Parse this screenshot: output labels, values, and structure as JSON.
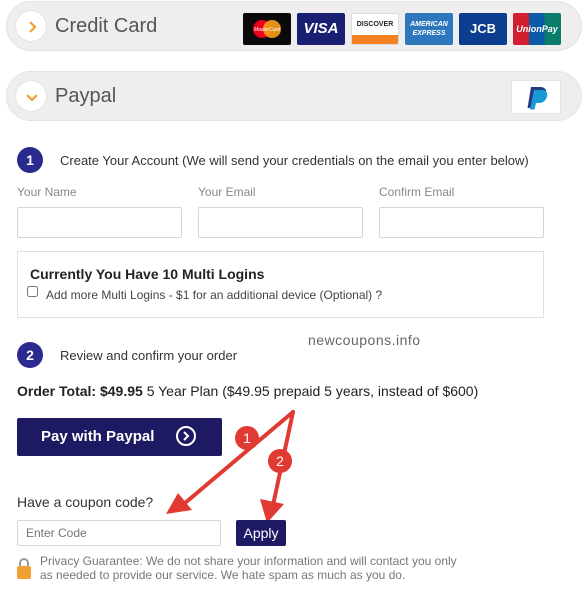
{
  "credit_card": {
    "title": "Credit Card",
    "cards": [
      "MasterCard",
      "VISA",
      "DISCOVER",
      "AMERICAN EXPRESS",
      "JCB",
      "UnionPay"
    ]
  },
  "paypal_panel": {
    "title": "Paypal"
  },
  "step1": {
    "number": "1",
    "text": "Create Your Account (We will send your credentials on the email you enter below)",
    "fields": {
      "name_label": "Your Name",
      "email_label": "Your Email",
      "confirm_label": "Confirm Email"
    }
  },
  "multi_logins": {
    "heading": "Currently You Have 10 Multi Logins",
    "checkbox_label": "Add more Multi Logins - $1 for an additional device (Optional) ?"
  },
  "watermark": "newcoupons.info",
  "step2": {
    "number": "2",
    "text": "Review and confirm your order"
  },
  "order": {
    "label": "Order Total:",
    "amount": "$49.95",
    "plan": "5 Year Plan ($49.95 prepaid 5 years, instead of $600)"
  },
  "pay_button": {
    "label": "Pay with Paypal"
  },
  "annotations": [
    "1",
    "2"
  ],
  "coupon": {
    "question": "Have a coupon code?",
    "placeholder": "Enter Code",
    "apply_label": "Apply"
  },
  "privacy": {
    "line1": "Privacy Guarantee: We do not share your information and will contact you only",
    "line2": "as needed to provide our service. We hate spam as much as you do."
  },
  "colors": {
    "accent": "#1d1a63",
    "step_circle": "#2a2a8f",
    "arrow_red": "#e03a32",
    "chevron": "#f0a030"
  }
}
